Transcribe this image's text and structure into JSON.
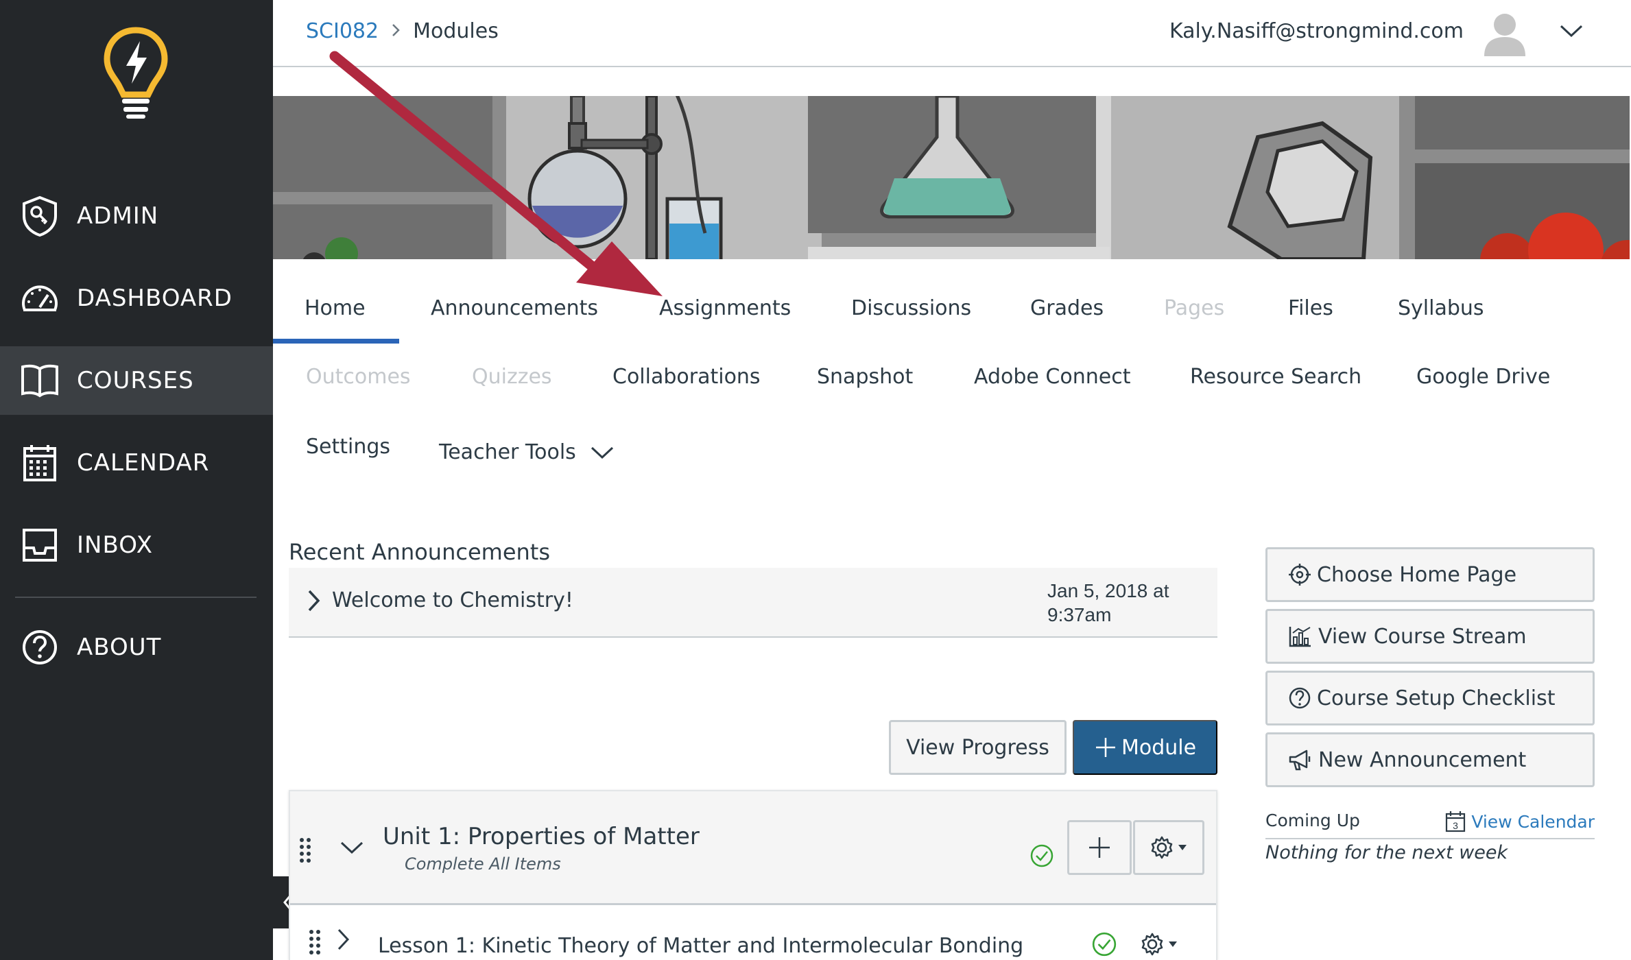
{
  "sidebar": {
    "items": [
      {
        "label": "ADMIN",
        "icon": "shield-icon"
      },
      {
        "label": "DASHBOARD",
        "icon": "gauge-icon"
      },
      {
        "label": "COURSES",
        "icon": "book-icon",
        "active": true
      },
      {
        "label": "CALENDAR",
        "icon": "calendar-icon"
      },
      {
        "label": "INBOX",
        "icon": "inbox-icon"
      },
      {
        "label": "ABOUT",
        "icon": "help-icon"
      }
    ]
  },
  "header": {
    "breadcrumb": {
      "course": "SCI082",
      "page": "Modules"
    },
    "user_email": "Kaly.Nasiff@strongmind.com"
  },
  "course_nav": {
    "tabs": [
      {
        "label": "Home",
        "active": true
      },
      {
        "label": "Announcements"
      },
      {
        "label": "Assignments"
      },
      {
        "label": "Discussions"
      },
      {
        "label": "Grades"
      },
      {
        "label": "Pages",
        "disabled": true
      },
      {
        "label": "Files"
      },
      {
        "label": "Syllabus"
      },
      {
        "label": "Outcomes",
        "disabled": true
      },
      {
        "label": "Quizzes",
        "disabled": true
      },
      {
        "label": "Collaborations"
      },
      {
        "label": "Snapshot"
      },
      {
        "label": "Adobe Connect"
      },
      {
        "label": "Resource Search"
      },
      {
        "label": "Google Drive"
      },
      {
        "label": "Settings"
      },
      {
        "label": "Teacher Tools"
      }
    ]
  },
  "announcements": {
    "title": "Recent Announcements",
    "items": [
      {
        "title": "Welcome to Chemistry!",
        "date_line1": "Jan 5, 2018 at",
        "date_line2": "9:37am"
      }
    ]
  },
  "actions": {
    "view_progress": "View Progress",
    "add_module": "Module"
  },
  "modules": [
    {
      "title": "Unit 1: Properties of Matter",
      "requirement": "Complete All Items",
      "items": [
        {
          "title": "Lesson 1: Kinetic Theory of Matter and Intermolecular Bonding"
        }
      ]
    }
  ],
  "right_sidebar": {
    "buttons": [
      {
        "label": "Choose Home Page",
        "icon": "target-icon"
      },
      {
        "label": "View Course Stream",
        "icon": "stream-chart-icon"
      },
      {
        "label": "Course Setup Checklist",
        "icon": "question-circle-icon"
      },
      {
        "label": "New Announcement",
        "icon": "megaphone-icon"
      }
    ],
    "coming_up": {
      "label": "Coming Up",
      "view_calendar": "View Calendar",
      "calendar_day": "3",
      "empty_text": "Nothing for the next week"
    }
  },
  "colors": {
    "sidebar_bg": "#24272a",
    "sidebar_active": "#3b3f43",
    "logo_yellow": "#f5b931",
    "link_blue": "#2b7abc",
    "primary_button": "#25608f",
    "tab_underline": "#2b65b8",
    "success_green": "#38a534",
    "annotation_arrow": "#b0283f"
  }
}
